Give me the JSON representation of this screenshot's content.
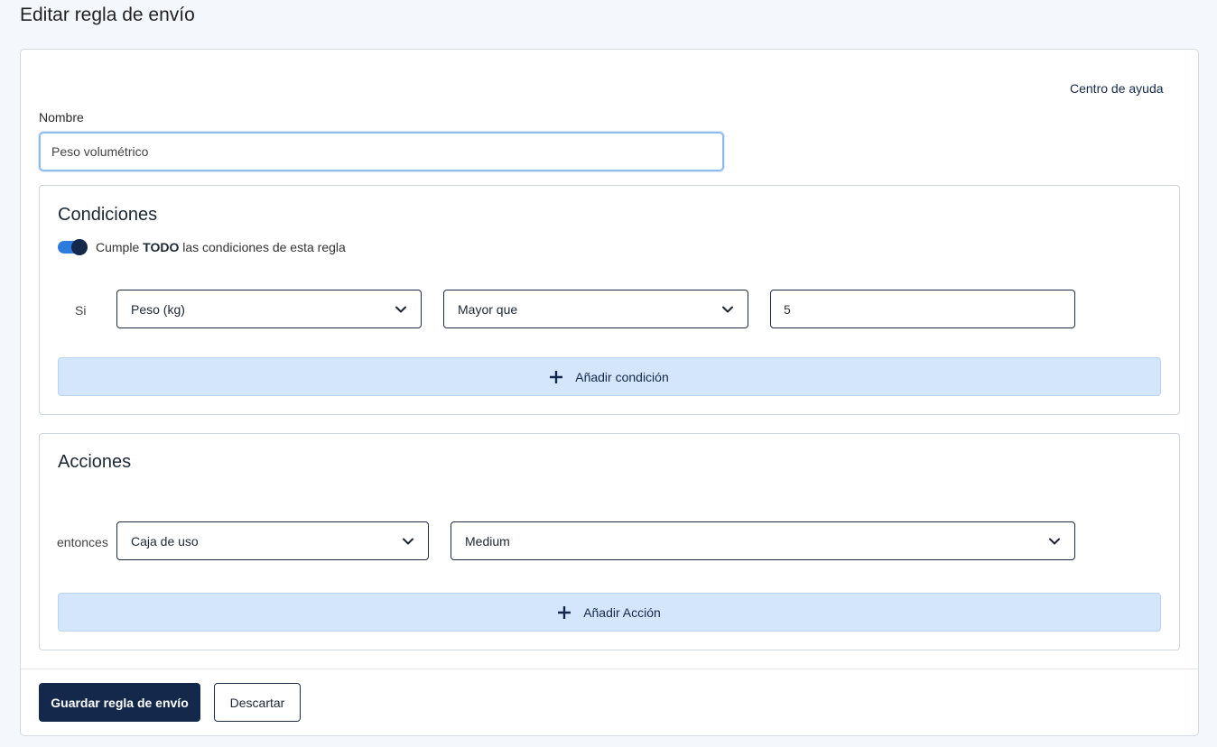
{
  "page": {
    "title": "Editar regla de envío"
  },
  "help": {
    "link_label": "Centro de ayuda"
  },
  "name": {
    "label": "Nombre",
    "value": "Peso volumétrico"
  },
  "conditions": {
    "title": "Condiciones",
    "toggle": {
      "prefix": "Cumple",
      "bold": "TODO",
      "suffix": "las condiciones de esta regla",
      "on": true
    },
    "row": {
      "label": "Si",
      "field": "Peso (kg)",
      "operator": "Mayor que",
      "value": "5"
    },
    "add_label": "Añadir condición"
  },
  "actions": {
    "title": "Acciones",
    "row": {
      "label": "entonces",
      "action": "Caja de uso",
      "value": "Medium"
    },
    "add_label": "Añadir Acción"
  },
  "footer": {
    "save_label": "Guardar regla de envío",
    "discard_label": "Descartar"
  },
  "colors": {
    "primary": "#13284b",
    "toggle_track": "#2e7be0",
    "add_bar": "#d4e6fb"
  },
  "icons": {
    "chevron": "chevron-down-icon",
    "plus": "plus-icon"
  }
}
